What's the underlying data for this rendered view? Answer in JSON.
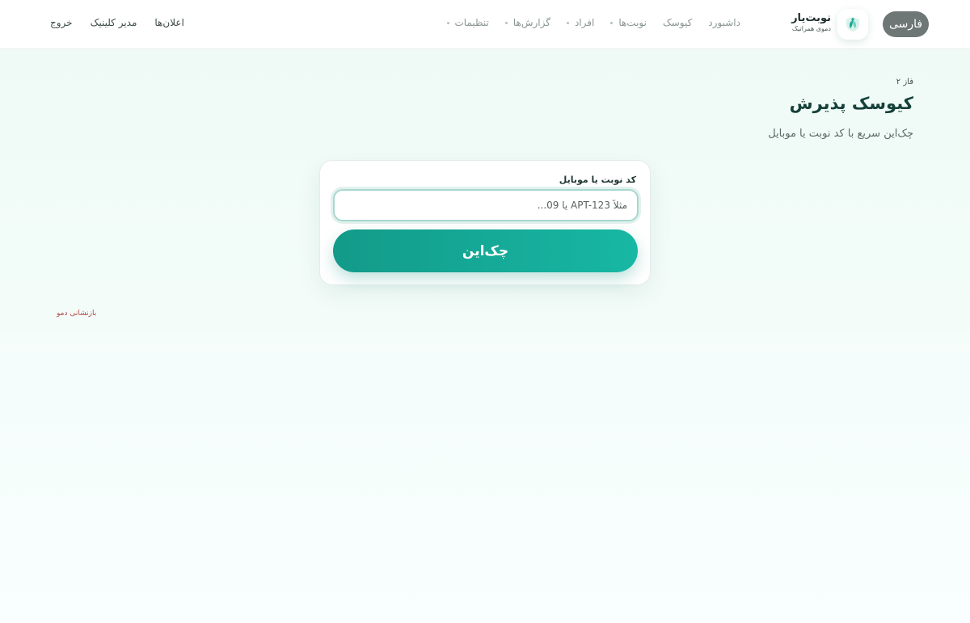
{
  "header": {
    "lang_label": "فارسی",
    "brand_title": "نوبت‌یار",
    "brand_subtitle": "دموی همراتیک",
    "nav": [
      {
        "label": "داشبورد",
        "dot": false
      },
      {
        "label": "کیوسک",
        "dot": false
      },
      {
        "label": "نوبت‌ها",
        "dot": true
      },
      {
        "label": "افراد",
        "dot": true
      },
      {
        "label": "گزارش‌ها",
        "dot": true
      },
      {
        "label": "تنظیمات",
        "dot": true
      }
    ],
    "announcements": "اعلان‌ها",
    "clinic_manager": "مدیر کلینیک",
    "logout": "خروج"
  },
  "hero": {
    "phase": "فاز ۲",
    "title": "کیوسک پذیرش",
    "subtitle": "چک‌این سریع با کد نوبت یا موبایل"
  },
  "form": {
    "label": "کد نوبت یا موبایل",
    "placeholder": "مثلاً APT-123 یا 09...",
    "value": "",
    "submit_label": "چک‌این"
  },
  "reset_demo": "بازنشانی دمو",
  "colors": {
    "accent_start": "#139a89",
    "accent_end": "#17b8a4",
    "lang_button": "#6e7775",
    "danger_link": "#b04a4a"
  },
  "icons": {
    "logo": "leaf-shield-icon"
  }
}
